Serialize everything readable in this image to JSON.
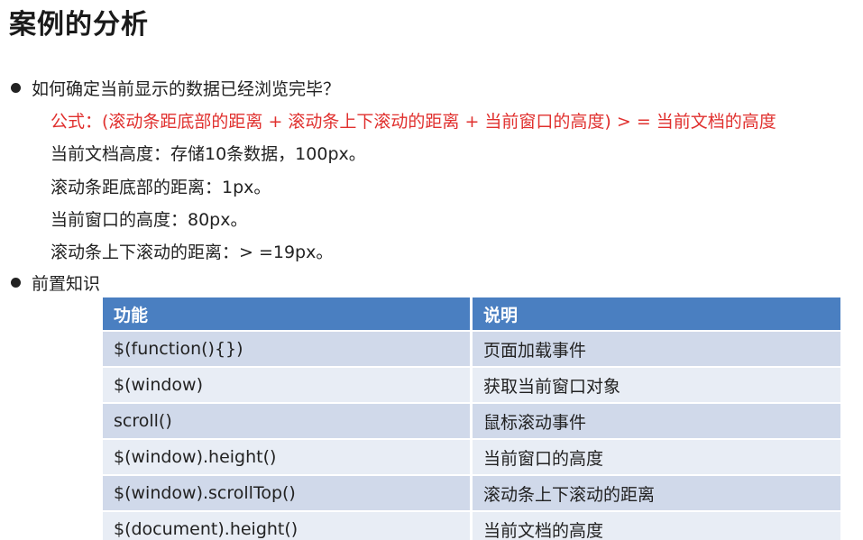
{
  "title": "案例的分析",
  "bullets": [
    {
      "text": "如何确定当前显示的数据已经浏览完毕？",
      "lines": [
        "公式：(滚动条距底部的距离 + 滚动条上下滚动的距离 + 当前窗口的高度) > = 当前文档的高度",
        "当前文档高度：存储10条数据，100px。",
        "滚动条距底部的距离：1px。",
        "当前窗口的高度：80px。",
        "滚动条上下滚动的距离：> =19px。"
      ]
    },
    {
      "text": "前置知识"
    }
  ],
  "table": {
    "headers": [
      "功能",
      "说明"
    ],
    "rows": [
      [
        "$(function(){})",
        "页面加载事件"
      ],
      [
        "$(window)",
        "获取当前窗口对象"
      ],
      [
        "scroll()",
        "鼠标滚动事件"
      ],
      [
        "$(window).height()",
        "当前窗口的高度"
      ],
      [
        "$(window).scrollTop()",
        "滚动条上下滚动的距离"
      ],
      [
        "$(document).height()",
        "当前文档的高度"
      ]
    ]
  },
  "colors": {
    "formula": "#e0302e",
    "header_bg": "#4a7fc1",
    "row_odd": "#d0d9ea",
    "row_even": "#e8edf5"
  }
}
